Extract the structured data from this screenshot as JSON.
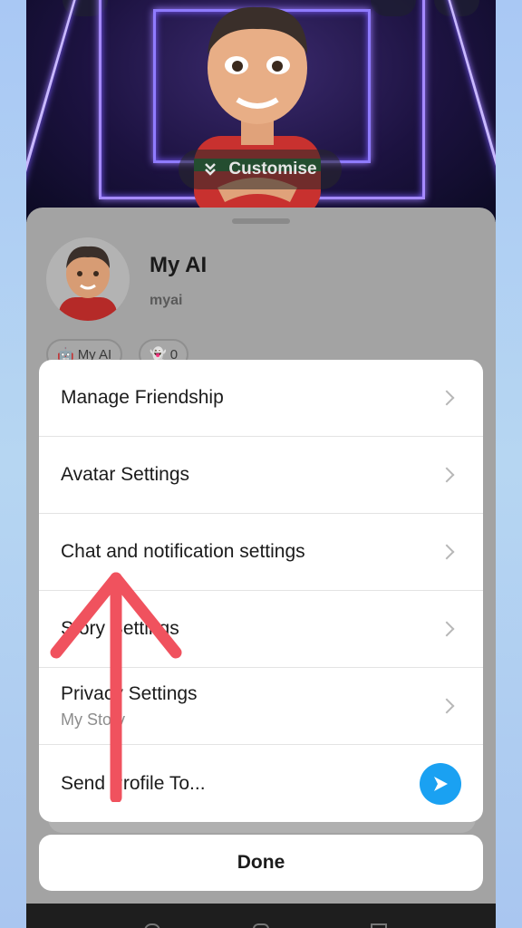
{
  "header": {
    "customise_label": "Customise"
  },
  "profile": {
    "name": "My AI",
    "username": "myai",
    "chips": [
      {
        "label": "My AI",
        "icon": "robot-icon"
      },
      {
        "label": "0",
        "icon": "ghost-icon"
      }
    ]
  },
  "menu": {
    "items": [
      {
        "label": "Manage Friendship"
      },
      {
        "label": "Avatar Settings"
      },
      {
        "label": "Chat and notification settings"
      },
      {
        "label": "Story Settings"
      },
      {
        "label": "Privacy Settings",
        "sublabel": "My Story"
      },
      {
        "label": "Send Profile To..."
      }
    ],
    "done_label": "Done"
  },
  "colors": {
    "accent_blue": "#1aa1f2",
    "annotation_arrow": "#f0525e"
  }
}
